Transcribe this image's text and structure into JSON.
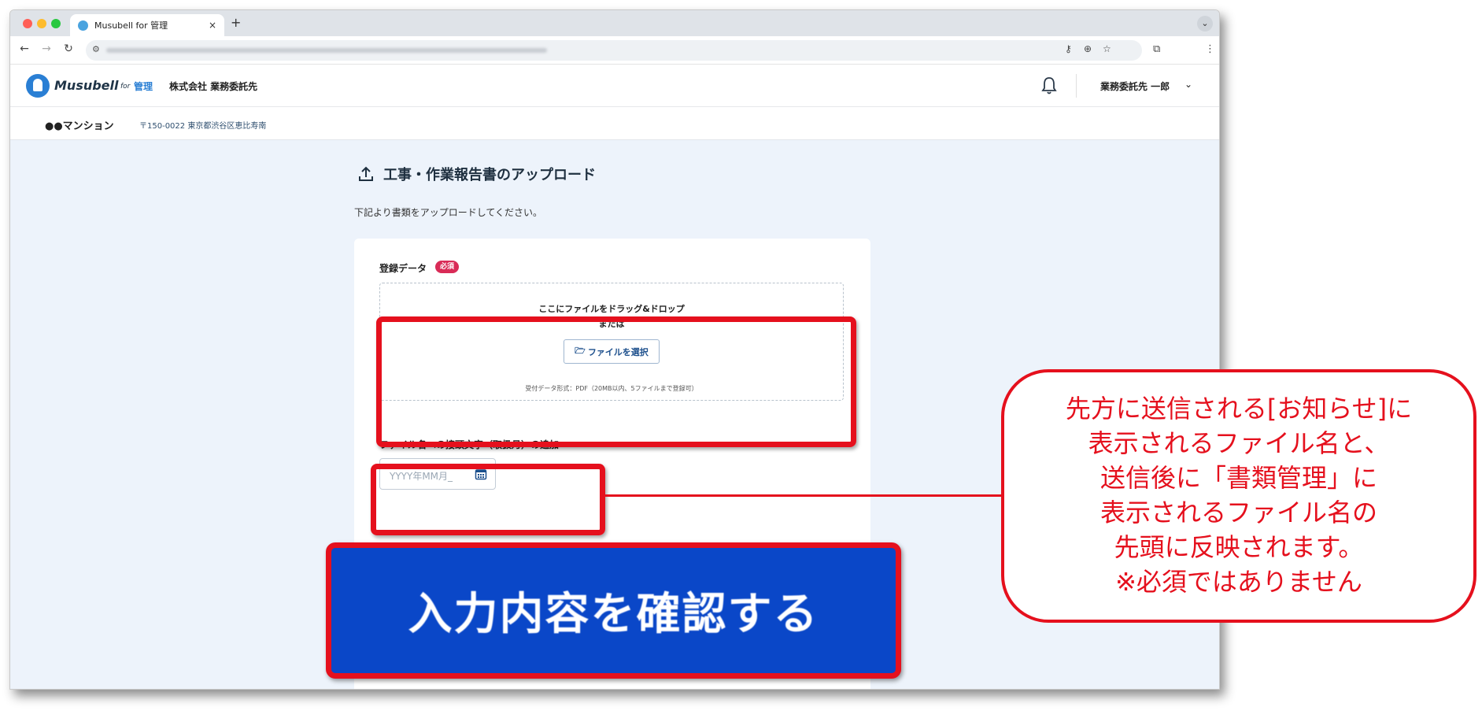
{
  "browser": {
    "tab_title": "Musubell for 管理",
    "tab_close": "×",
    "new_tab": "+",
    "tab_menu": "⌄"
  },
  "header": {
    "logo_text": "Musubell",
    "logo_for": "for",
    "logo_kanri": "管理",
    "company": "株式会社 業務委託先",
    "user_name": "業務委託先 一郎"
  },
  "property": {
    "name": "●●マンション",
    "address": "〒150-0022 東京都渋谷区恵比寿南"
  },
  "page": {
    "title": "工事・作業報告書のアップロード",
    "description": "下記より書類をアップロードしてください。"
  },
  "form": {
    "data_label": "登録データ",
    "required_badge": "必須",
    "drop_line1": "ここにファイルをドラッグ&ドロップ",
    "drop_line2": "または",
    "select_button": "ファイルを選択",
    "drop_note": "受付データ形式：PDF（20MB以内、5ファイルまで登録可）",
    "prefix_label": "ファイル名への接頭文字（取扱月）の追加",
    "date_placeholder": "YYYY年MM月_",
    "confirm_button": "入力内容を確認する"
  },
  "annotation": {
    "callout_text": "先方に送信される[お知らせ]に\n表示されるファイル名と、\n送信後に「書類管理」に\n表示されるファイル名の\n先頭に反映されます。\n※必須ではありません",
    "highlight_color": "#e5101d"
  },
  "colors": {
    "accent": "#2a7fd4",
    "button_blue": "#0a47c8",
    "required": "#d92b57",
    "page_bg": "#edf3fb"
  }
}
